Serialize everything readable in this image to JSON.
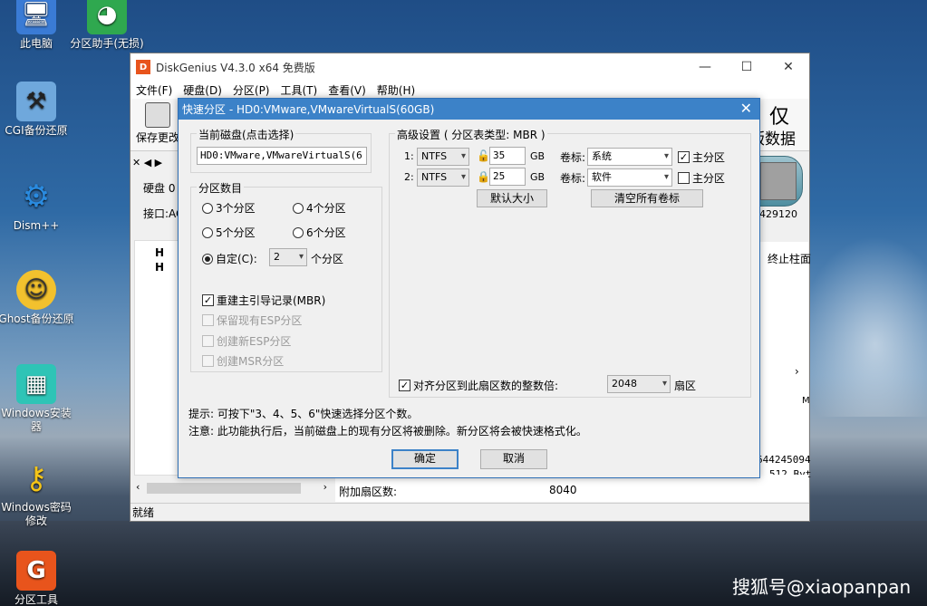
{
  "desktop": {
    "icons": [
      {
        "label": "此电脑",
        "glyph": "🖥"
      },
      {
        "label": "分区助手(无损)",
        "glyph": "◕"
      },
      {
        "label": "CGI备份还原",
        "glyph": "⚒"
      },
      {
        "label": "Dism++",
        "glyph": "⚙"
      },
      {
        "label": "Ghost备份还原",
        "glyph": "☺"
      },
      {
        "label": "Windows安装器",
        "glyph": "▦"
      },
      {
        "label": "Windows密码修改",
        "glyph": "⚷"
      },
      {
        "label": "分区工具",
        "glyph": "G"
      }
    ],
    "watermark": "搜狐号@xiaopanpan"
  },
  "main_window": {
    "title": "DiskGenius V4.3.0 x64 免费版",
    "controls": {
      "minimize": "—",
      "maximize": "☐",
      "close": "✕"
    },
    "menu": [
      "文件(F)",
      "硬盘(D)",
      "分区(P)",
      "工具(T)",
      "查看(V)",
      "帮助(H)"
    ],
    "toolbar": {
      "save": "保存更改"
    },
    "brand": {
      "line1": "仅",
      "line2": "版数据"
    },
    "left_panel": {
      "disk_label": "硬盘 0",
      "interface_label": "接口:AC",
      "tree_h1": "H",
      "tree_h2": "H"
    },
    "right_col": {
      "header": "终止柱面",
      "disk_number": "429120",
      "value1": "644245094",
      "value2": "512 Byt",
      "mb": "M"
    },
    "info_row": {
      "label": "附加扇区数:",
      "value": "8040"
    },
    "status": "就绪"
  },
  "dialog": {
    "title": "快速分区 - HD0:VMware,VMwareVirtualS(60GB)",
    "close": "✕",
    "current_disk": {
      "label": "当前磁盘(点击选择)",
      "value": "HD0:VMware,VMwareVirtualS(6"
    },
    "partition_count": {
      "label": "分区数目",
      "options": [
        "3个分区",
        "4个分区",
        "5个分区",
        "6个分区"
      ],
      "custom_label": "自定(C):",
      "custom_value": "2",
      "custom_suffix": "个分区"
    },
    "options": {
      "rebuild_mbr": "重建主引导记录(MBR)",
      "keep_esp": "保留现有ESP分区",
      "create_esp": "创建新ESP分区",
      "create_msr": "创建MSR分区"
    },
    "advanced": {
      "label": "高级设置 ( 分区表类型: MBR )",
      "rows": [
        {
          "index": "1:",
          "fs": "NTFS",
          "size": "35",
          "unit": "GB",
          "vol_label": "卷标:",
          "vol": "系统",
          "primary": "主分区",
          "primary_checked": true
        },
        {
          "index": "2:",
          "fs": "NTFS",
          "size": "25",
          "unit": "GB",
          "vol_label": "卷标:",
          "vol": "软件",
          "primary": "主分区",
          "primary_checked": false
        }
      ],
      "default_size_btn": "默认大小",
      "clear_labels_btn": "清空所有卷标",
      "align_label": "对齐分区到此扇区数的整数倍:",
      "align_value": "2048",
      "align_unit": "扇区"
    },
    "tip1": "提示: 可按下\"3、4、5、6\"快速选择分区个数。",
    "tip2": "注意: 此功能执行后，当前磁盘上的现有分区将被删除。新分区将会被快速格式化。",
    "ok": "确定",
    "cancel": "取消"
  }
}
